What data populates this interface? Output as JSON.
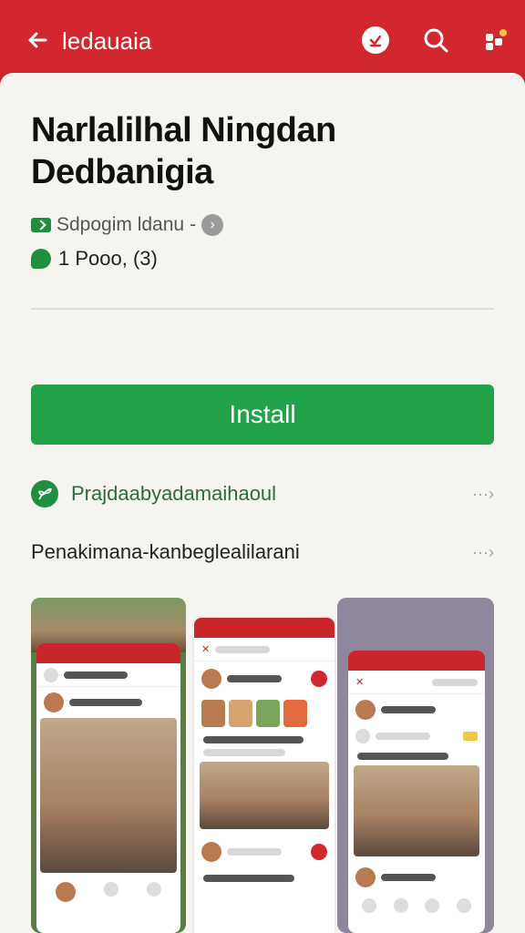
{
  "header": {
    "title": "ledauaia",
    "icons": {
      "back": "arrow-left-icon",
      "badge": "download-badge-icon",
      "search": "search-icon",
      "more": "grid-dots-icon"
    }
  },
  "app": {
    "title_line1": "Narlalilhal Ningdan",
    "title_line2": "Dedbanigia",
    "developer": "Sdpogim ldanu",
    "dash": "-",
    "downloads": "1 Pooo, (3)"
  },
  "install_label": "Install",
  "rows": {
    "first": "Prajdaabyadamaihaoul",
    "second": "Penakimana-kanbeglealilarani",
    "more": "···"
  },
  "colors": {
    "brand_red": "#d2272e",
    "install_green": "#22a34a",
    "sheet_bg": "#f6f4ef"
  }
}
